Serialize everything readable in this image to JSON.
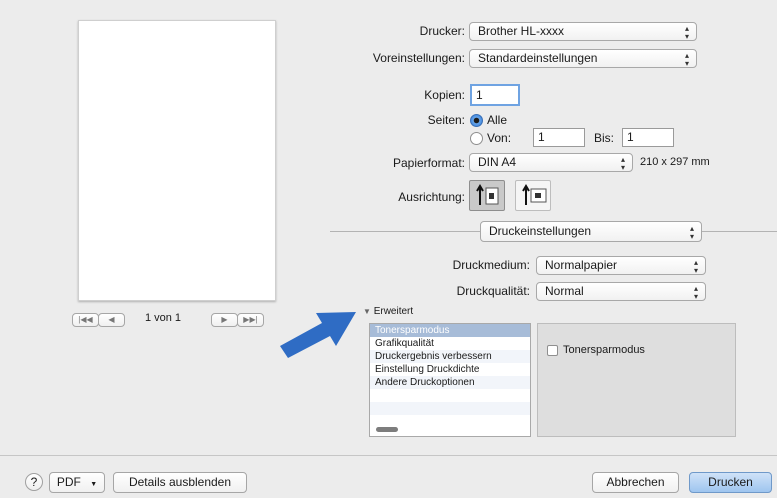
{
  "printer": {
    "label": "Drucker:",
    "value": "Brother HL-xxxx"
  },
  "presets": {
    "label": "Voreinstellungen:",
    "value": "Standardeinstellungen"
  },
  "copies": {
    "label": "Kopien:",
    "value": "1"
  },
  "pages": {
    "label": "Seiten:",
    "all_label": "Alle",
    "from_label": "Von:",
    "from_value": "1",
    "to_label": "Bis:",
    "to_value": "1"
  },
  "paper": {
    "label": "Papierformat:",
    "value": "DIN A4",
    "size_text": "210 x 297 mm"
  },
  "orientation": {
    "label": "Ausrichtung:"
  },
  "section": {
    "value": "Druckeinstellungen"
  },
  "media": {
    "label": "Druckmedium:",
    "value": "Normalpapier"
  },
  "quality": {
    "label": "Druckqualität:",
    "value": "Normal"
  },
  "advanced": {
    "label": "Erweitert",
    "items": [
      "Tonersparmodus",
      "Grafikqualität",
      "Druckergebnis verbessern",
      "Einstellung Druckdichte",
      "Andere Druckoptionen"
    ],
    "checkbox_label": "Tonersparmodus"
  },
  "preview": {
    "page_text": "1 von 1"
  },
  "footer": {
    "help": "?",
    "pdf": "PDF",
    "details": "Details ausblenden",
    "cancel": "Abbrechen",
    "print": "Drucken"
  },
  "colors": {
    "accent": "#3f86de",
    "selection": "#a7bcd8",
    "arrow": "#2f6cc4"
  },
  "icons": {
    "portrait": "portrait-orientation-icon",
    "landscape": "landscape-orientation-icon",
    "annotation_arrow": "arrow-right-icon"
  }
}
